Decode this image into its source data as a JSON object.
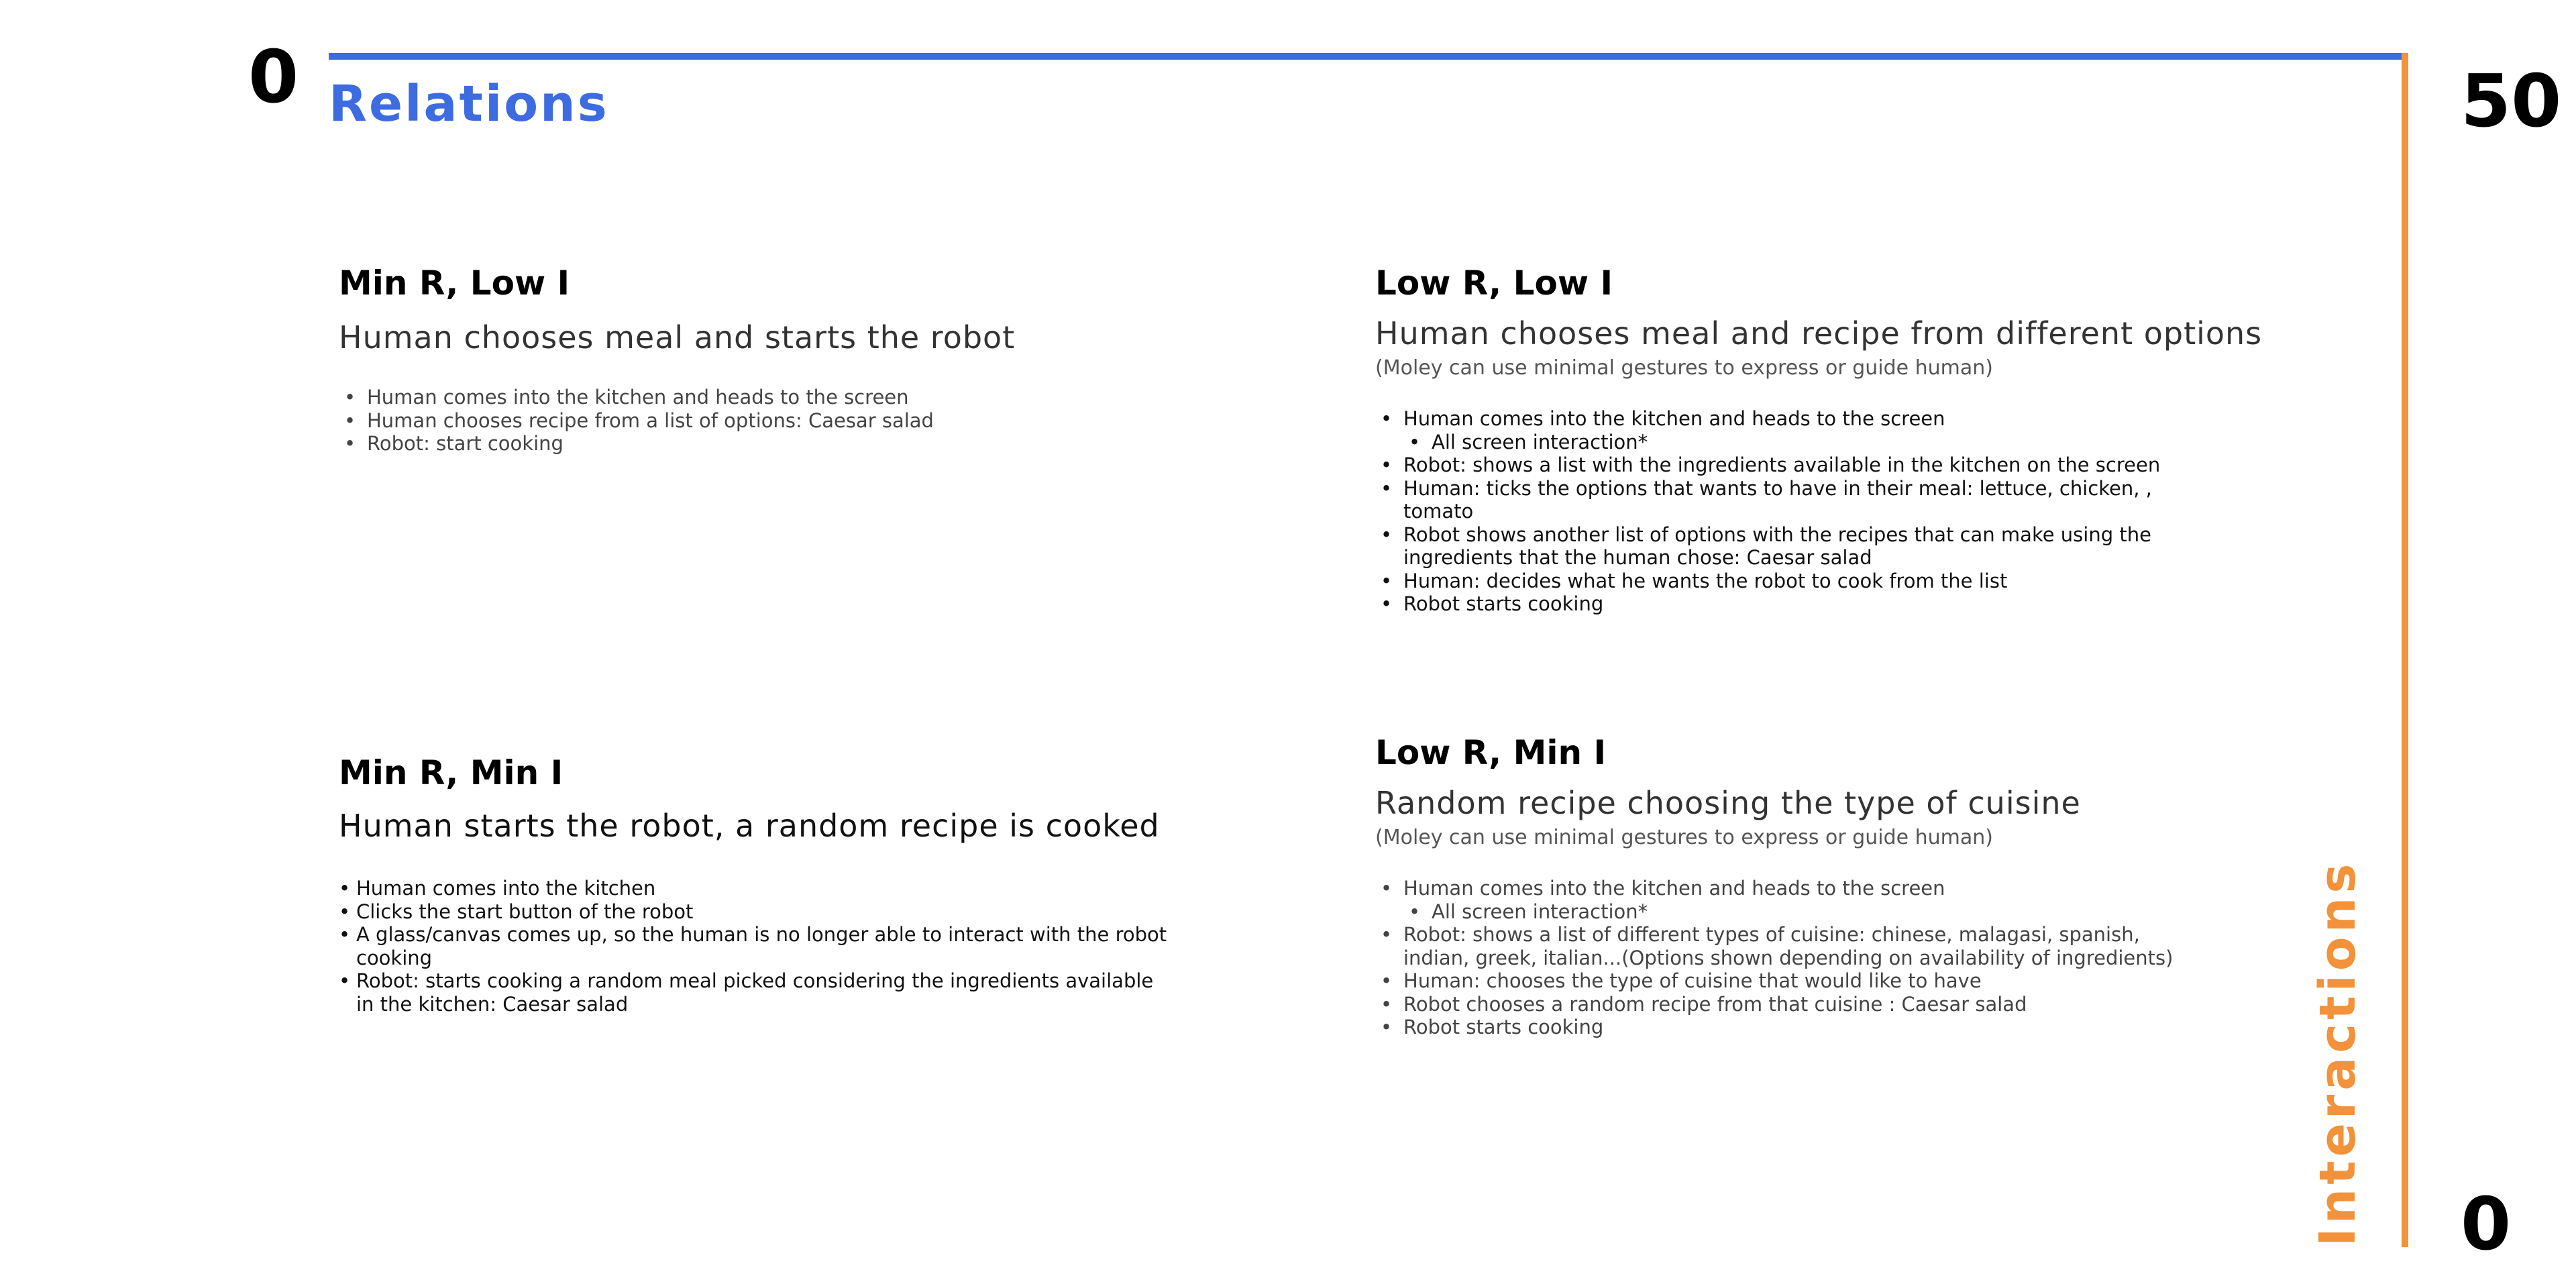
{
  "axes": {
    "top_left_number": "0",
    "top_right_number": "50",
    "bottom_right_number": "0",
    "horizontal_label": "Relations",
    "vertical_label": "Interactions",
    "horizontal_color": "#3d6be0",
    "vertical_color": "#f2923a"
  },
  "quadrants": [
    {
      "title": "Min R, Low I",
      "subtitle": "Human chooses meal and starts the robot",
      "note": "",
      "items": [
        {
          "text": "Human comes into the kitchen and heads to the screen",
          "level": 1
        },
        {
          "text": "Human chooses recipe from a list of options: Caesar salad",
          "level": 1
        },
        {
          "text": "Robot: start cooking",
          "level": 1
        }
      ]
    },
    {
      "title": "Low R, Low I",
      "subtitle": "Human chooses meal and recipe from different options",
      "note": "(Moley can use minimal gestures to express or guide human)",
      "items": [
        {
          "text": "Human comes into the kitchen and heads to the screen",
          "level": 1
        },
        {
          "text": "All screen interaction*",
          "level": 2
        },
        {
          "text": "Robot: shows a list with the ingredients available in the kitchen on the screen",
          "level": 1
        },
        {
          "text": "Human: ticks the options that wants to have in their meal: lettuce, chicken, , tomato",
          "level": 1
        },
        {
          "text": "Robot shows another list of options with the recipes that can make using the ingredients that the human chose: Caesar salad",
          "level": 1
        },
        {
          "text": "Human: decides what he wants the robot to cook from the list",
          "level": 1
        },
        {
          "text": "Robot starts cooking",
          "level": 1
        }
      ]
    },
    {
      "title": "Min R, Min I",
      "subtitle": "Human starts the robot, a random recipe is cooked",
      "note": "",
      "items": [
        {
          "text": "Human comes into the kitchen",
          "level": 1
        },
        {
          "text": "Clicks the start button of the robot",
          "level": 1
        },
        {
          "text": "A glass/canvas comes up, so the human is no longer able to interact with the robot cooking",
          "level": 1
        },
        {
          "text": "Robot: starts cooking a random meal picked considering the ingredients available in the kitchen: Caesar salad",
          "level": 1
        }
      ]
    },
    {
      "title": "Low R, Min I",
      "subtitle": "Random recipe choosing the type of cuisine",
      "note": "(Moley can use minimal gestures to express or guide human)",
      "items": [
        {
          "text": "Human comes into the kitchen and heads to the screen",
          "level": 1
        },
        {
          "text": "All screen interaction*",
          "level": 2
        },
        {
          "text": "Robot: shows a list of different types of cuisine: chinese, malagasi, spanish, indian, greek, italian...(Options shown depending on availability of ingredients)",
          "level": 1
        },
        {
          "text": "Human: chooses the type of cuisine that would like to have",
          "level": 1
        },
        {
          "text": "Robot chooses a random recipe from that cuisine : Caesar salad",
          "level": 1
        },
        {
          "text": "Robot starts cooking",
          "level": 1
        }
      ]
    }
  ]
}
